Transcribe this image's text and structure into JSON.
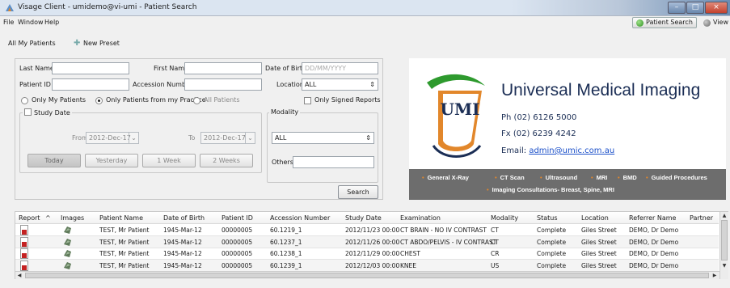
{
  "window": {
    "title": "Visage Client - umidemo@vi-umi - Patient Search"
  },
  "menu": {
    "file": "File",
    "window": "Window",
    "help": "Help"
  },
  "top_tabs": {
    "patient_search": "Patient Search",
    "view": "View"
  },
  "toolbar": {
    "all_my_patients": "All My Patients",
    "new_preset": "New Preset"
  },
  "form": {
    "last_name_label": "Last Name",
    "last_name_value": "",
    "first_name_label": "First Name",
    "first_name_value": "",
    "dob_label": "Date of Birth",
    "dob_placeholder": "DD/MM/YYYY",
    "patient_id_label": "Patient ID",
    "patient_id_value": "",
    "accession_label": "Accession Number",
    "accession_value": "",
    "location_label": "Location",
    "location_value": "ALL",
    "only_my_patients": "Only My Patients",
    "only_practice": "Only Patients from my Practice",
    "all_patients": "All Patients",
    "only_signed": "Only Signed Reports",
    "study_date_label": "Study Date",
    "from_label": "From",
    "from_value": "2012-Dec-17",
    "to_label": "To",
    "to_value": "2012-Dec-17",
    "today": "Today",
    "yesterday": "Yesterday",
    "one_week": "1 Week",
    "two_weeks": "2 Weeks",
    "modality_label": "Modality",
    "modality_value": "ALL",
    "others_label": "Others",
    "others_value": "",
    "search": "Search"
  },
  "banner": {
    "logo_text": "UMI",
    "brand": "Universal Medical Imaging",
    "phone": "Ph (02) 6126 5000",
    "fax": "Fx  (02) 6239 4242",
    "email_label": "Email:",
    "email": "admin@umic.com.au",
    "services_row1": [
      "General X-Ray",
      "CT Scan",
      "Ultrasound",
      "MRI",
      "BMD",
      "Guided Procedures"
    ],
    "services_row2": "Imaging Consultations- Breast, Spine, MRI"
  },
  "table": {
    "headers": [
      "Report",
      "Images",
      "Patient Name",
      "Date of Birth",
      "Patient ID",
      "Accession Number",
      "Study Date",
      "Examination",
      "Modality",
      "Status",
      "Location",
      "Referrer Name",
      "Partner"
    ],
    "rows": [
      [
        "TEST, Mr Patient",
        "1945-Mar-12",
        "00000005",
        "60.1219_1",
        "2012/11/23 00:00",
        "CT BRAIN - NO IV CONTRAST",
        "CT",
        "Complete",
        "Giles Street",
        "DEMO, Dr Demo"
      ],
      [
        "TEST, Mr Patient",
        "1945-Mar-12",
        "00000005",
        "60.1237_1",
        "2012/11/26 00:00",
        "CT ABDO/PELVIS - IV CONTRAST",
        "CT",
        "Complete",
        "Giles Street",
        "DEMO, Dr Demo"
      ],
      [
        "TEST, Mr Patient",
        "1945-Mar-12",
        "00000005",
        "60.1238_1",
        "2012/11/29 00:00",
        "CHEST",
        "CR",
        "Complete",
        "Giles Street",
        "DEMO, Dr Demo"
      ],
      [
        "TEST, Mr Patient",
        "1945-Mar-12",
        "00000005",
        "60.1239_1",
        "2012/12/03 00:00",
        "KNEE",
        "US",
        "Complete",
        "Giles Street",
        "DEMO, Dr Demo"
      ]
    ]
  },
  "icons": {
    "app": "visage-app-icon",
    "report": "report-document-icon",
    "images": "image-thumbnail-icon"
  },
  "colors": {
    "brand_navy": "#1b2e55",
    "strip_gray": "#6d6d6d",
    "bullet_orange": "#e2872b",
    "logo_green": "#2e9a2e",
    "logo_orange": "#e2872b"
  }
}
